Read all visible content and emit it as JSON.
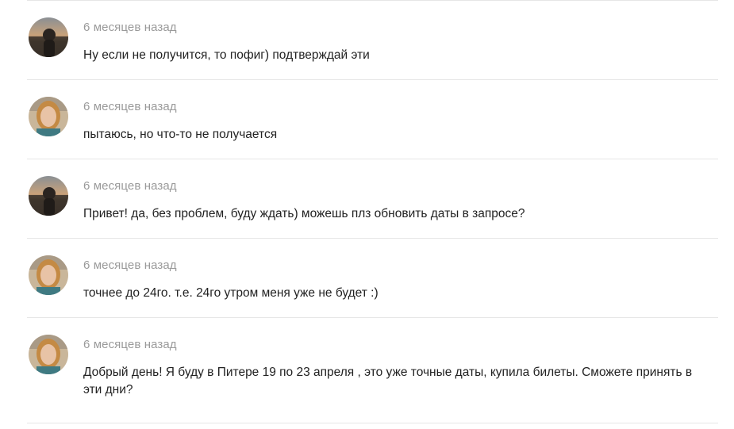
{
  "messages": [
    {
      "time": "6 месяцев назад",
      "text": "Ну если не получится, то пофиг) подтверждай эти",
      "avatar": "avatar-sunset-icon"
    },
    {
      "time": "6 месяцев назад",
      "text": "пытаюсь, но что-то не получается",
      "avatar": "avatar-woman-icon"
    },
    {
      "time": "6 месяцев назад",
      "text": "Привет! да, без проблем, буду ждать) можешь плз обновить даты в запросе?",
      "avatar": "avatar-sunset-icon"
    },
    {
      "time": "6 месяцев назад",
      "text": "точнее до 24го. т.е. 24го утром меня уже не будет :)",
      "avatar": "avatar-woman-icon"
    },
    {
      "time": "6 месяцев назад",
      "text": "Добрый день! Я буду в Питере 19 по 23 апреля , это уже точные даты, купила билеты. Сможете принять в эти дни?",
      "avatar": "avatar-woman-icon"
    }
  ]
}
